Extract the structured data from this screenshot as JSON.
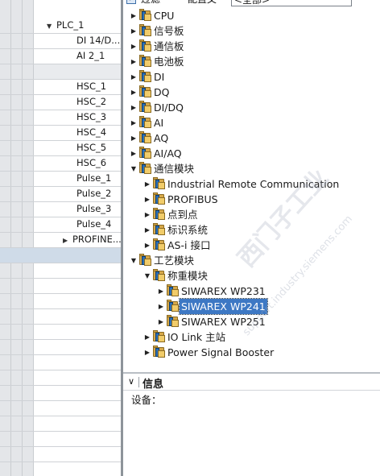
{
  "device_overview": {
    "rows": [
      {
        "label": "PLC_1",
        "expanded": true
      },
      {
        "label": "DI 14/D..."
      },
      {
        "label": "AI 2_1"
      },
      {
        "label": ""
      },
      {
        "label": "HSC_1"
      },
      {
        "label": "HSC_2"
      },
      {
        "label": "HSC_3"
      },
      {
        "label": "HSC_4"
      },
      {
        "label": "HSC_5"
      },
      {
        "label": "HSC_6"
      },
      {
        "label": "Pulse_1"
      },
      {
        "label": "Pulse_2"
      },
      {
        "label": "Pulse_3"
      },
      {
        "label": "Pulse_4"
      },
      {
        "label": "PROFINE...",
        "collapsed": true
      }
    ]
  },
  "catalog": {
    "filter_checkbox_label": "过滤",
    "profile_label": "配置文",
    "profile_value": "<全部>",
    "tree": [
      {
        "label": "CPU",
        "level": 0,
        "state": "collapsed"
      },
      {
        "label": "信号板",
        "level": 0,
        "state": "collapsed"
      },
      {
        "label": "通信板",
        "level": 0,
        "state": "collapsed"
      },
      {
        "label": "电池板",
        "level": 0,
        "state": "collapsed"
      },
      {
        "label": "DI",
        "level": 0,
        "state": "collapsed"
      },
      {
        "label": "DQ",
        "level": 0,
        "state": "collapsed"
      },
      {
        "label": "DI/DQ",
        "level": 0,
        "state": "collapsed"
      },
      {
        "label": "AI",
        "level": 0,
        "state": "collapsed"
      },
      {
        "label": "AQ",
        "level": 0,
        "state": "collapsed"
      },
      {
        "label": "AI/AQ",
        "level": 0,
        "state": "collapsed"
      },
      {
        "label": "通信模块",
        "level": 0,
        "state": "expanded"
      },
      {
        "label": "Industrial Remote Communication",
        "level": 1,
        "state": "collapsed"
      },
      {
        "label": "PROFIBUS",
        "level": 1,
        "state": "collapsed"
      },
      {
        "label": "点到点",
        "level": 1,
        "state": "collapsed"
      },
      {
        "label": "标识系统",
        "level": 1,
        "state": "collapsed"
      },
      {
        "label": "AS-i 接口",
        "level": 1,
        "state": "collapsed"
      },
      {
        "label": "工艺模块",
        "level": 0,
        "state": "expanded"
      },
      {
        "label": "称重模块",
        "level": 1,
        "state": "expanded"
      },
      {
        "label": "SIWAREX WP231",
        "level": 2,
        "state": "collapsed"
      },
      {
        "label": "SIWAREX WP241",
        "level": 2,
        "state": "collapsed",
        "selected": true
      },
      {
        "label": "SIWAREX WP251",
        "level": 2,
        "state": "collapsed"
      },
      {
        "label": "IO Link 主站",
        "level": 1,
        "state": "collapsed"
      },
      {
        "label": "Power Signal Booster",
        "level": 1,
        "state": "collapsed"
      }
    ]
  },
  "info_panel": {
    "title": "信息",
    "device_label": "设备："
  },
  "watermark": {
    "line1": "西门子工业",
    "line2": "support.industry.siemens.com"
  }
}
